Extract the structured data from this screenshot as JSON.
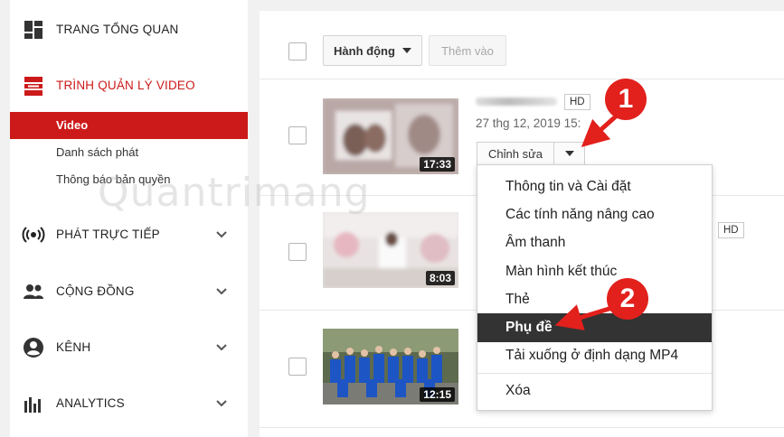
{
  "sidebar": {
    "dashboard_label": "TRANG TỔNG QUAN",
    "video_manager_label": "TRÌNH QUẢN LÝ VIDEO",
    "sub_items": [
      "Video",
      "Danh sách phát",
      "Thông báo bản quyền"
    ],
    "live_label": "PHÁT TRỰC TIẾP",
    "community_label": "CỘNG ĐỒNG",
    "channel_label": "KÊNH",
    "analytics_label": "ANALYTICS"
  },
  "toolbar": {
    "actions_label": "Hành động",
    "add_to_label": "Thêm vào"
  },
  "videos": [
    {
      "duration": "17:33",
      "hd": "HD",
      "date": "27 thg 12, 2019 15:",
      "edit_label": "Chỉnh sửa"
    },
    {
      "duration": "8:03",
      "hd": "HD"
    },
    {
      "duration": "12:15"
    }
  ],
  "edit_menu": {
    "items": [
      "Thông tin và Cài đặt",
      "Các tính năng nâng cao",
      "Âm thanh",
      "Màn hình kết thúc",
      "Thẻ",
      "Phụ đề",
      "Tải xuống ở định dạng MP4",
      "Xóa"
    ],
    "selected": "Phụ đề"
  },
  "annotations": {
    "step1": "1",
    "step2": "2"
  },
  "watermark": "Quantrimang",
  "colors": {
    "accent_red": "#cc1a1a",
    "annotation_red": "#e2201c",
    "menu_active": "#333333"
  },
  "icons": [
    "dashboard-icon",
    "video-manager-icon",
    "live-broadcast-icon",
    "community-icon",
    "channel-icon",
    "analytics-icon",
    "chevron-down-icon"
  ]
}
